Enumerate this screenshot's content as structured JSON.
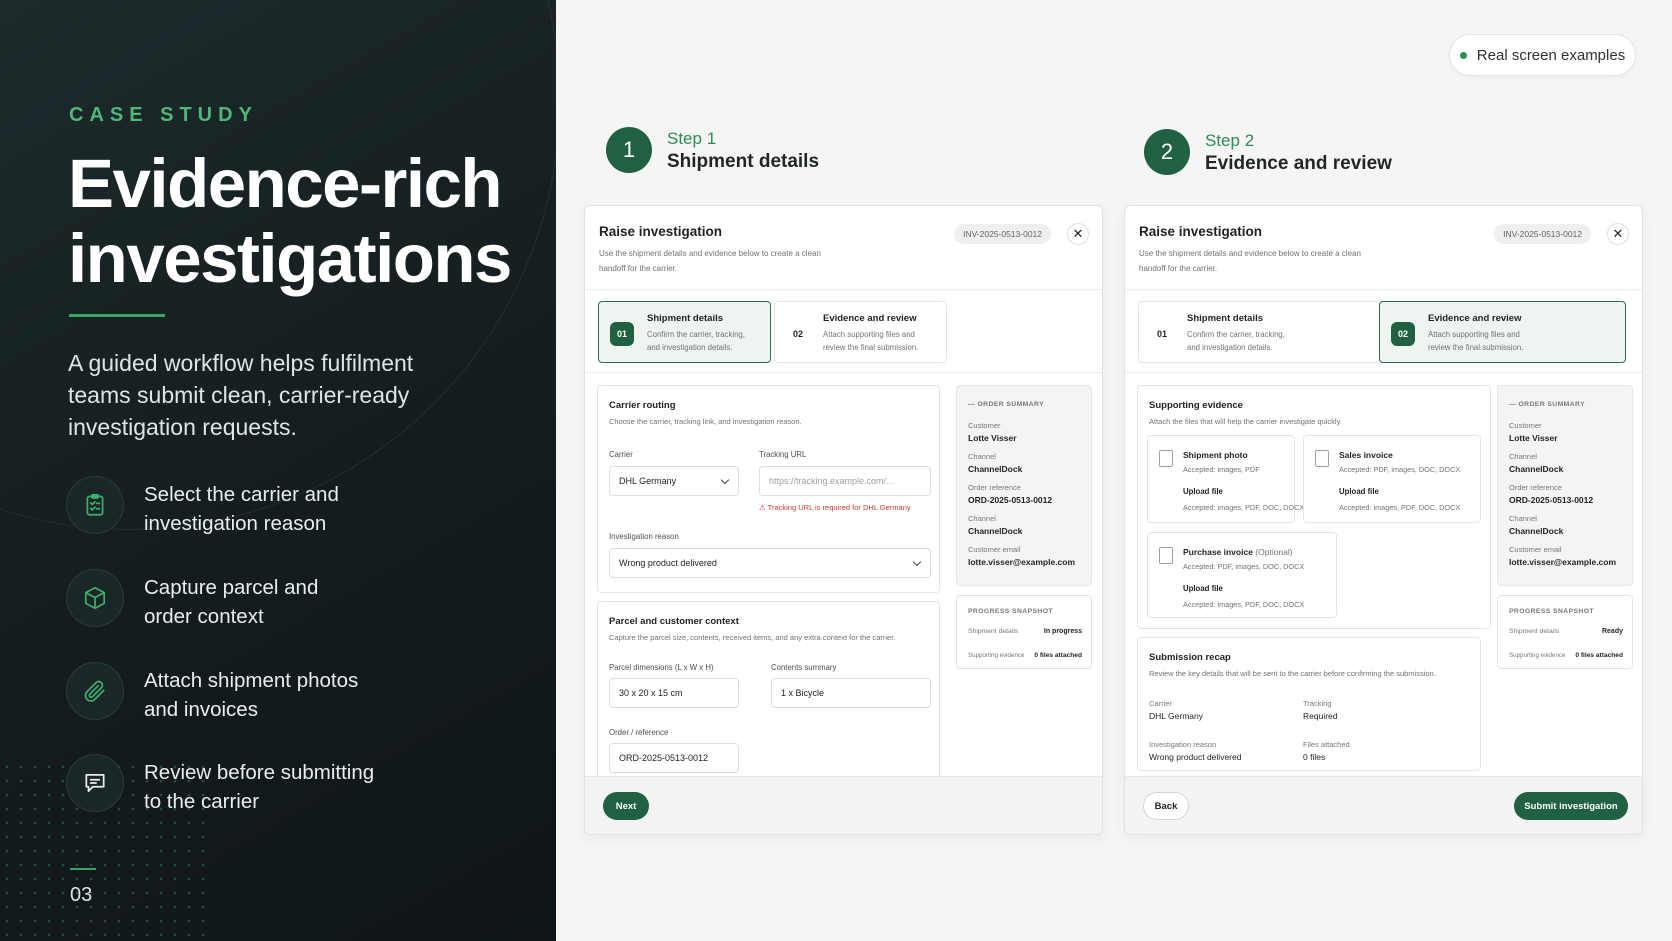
{
  "left": {
    "eyebrow": "CASE STUDY",
    "title_line1": "Evidence-rich",
    "title_line2": "investigations",
    "lead": "A guided workflow helps fulfilment teams submit clean, carrier-ready investigation requests.",
    "features": [
      {
        "icon": "clipboard-check-icon",
        "line1": "Select the carrier and",
        "line2": "investigation reason"
      },
      {
        "icon": "box-icon",
        "line1": "Capture parcel and",
        "line2": "order context"
      },
      {
        "icon": "paperclip-icon",
        "line1": "Attach shipment photos",
        "line2": "and invoices"
      },
      {
        "icon": "message-icon",
        "line1": "Review before submitting",
        "line2": "to the carrier"
      }
    ],
    "page_number": "03"
  },
  "badge": {
    "label": "Real screen examples"
  },
  "steps": [
    {
      "number": "1",
      "label": "Step 1",
      "title": "Shipment details"
    },
    {
      "number": "2",
      "label": "Step 2",
      "title": "Evidence and review"
    }
  ],
  "modal": {
    "title": "Raise investigation",
    "subtitle_line1": "Use the shipment details and evidence below to create a clean",
    "subtitle_line2": "handoff for the carrier.",
    "reference": "INV-2025-0513-0012",
    "close": "✕",
    "tabs": [
      {
        "number": "01",
        "title": "Shipment details",
        "desc_line1": "Confirm the carrier, tracking,",
        "desc_line2": "and investigation details."
      },
      {
        "number": "02",
        "title": "Evidence and review",
        "desc_line1": "Attach supporting files and",
        "desc_line2": "review the final submission."
      }
    ],
    "order_summary": {
      "heading": "ORDER SUMMARY",
      "customer_label": "Customer",
      "customer": "Lotte Visser",
      "channel_label": "Channel",
      "channel": "ChannelDock",
      "order_ref_label": "Order reference",
      "order_ref": "ORD-2025-0513-0012",
      "channel2_label": "Channel",
      "channel2": "ChannelDock",
      "email_label": "Customer email",
      "email": "lotte.visser@example.com"
    },
    "snapshot": {
      "heading": "PROGRESS SNAPSHOT",
      "row1_label": "Shipment details",
      "row2_label": "Supporting evidence",
      "row2_value": "0 files attached"
    }
  },
  "screen1": {
    "carrier_panel": {
      "title": "Carrier routing",
      "desc": "Choose the carrier, tracking link, and investigation reason.",
      "carrier_label": "Carrier",
      "carrier_value": "DHL Germany",
      "tracking_label": "Tracking URL",
      "tracking_placeholder": "https://tracking.example.com/...",
      "tracking_error": "⚠ Tracking URL is required for DHL Germany",
      "reason_label": "Investigation reason",
      "reason_value": "Wrong product delivered"
    },
    "parcel_panel": {
      "title": "Parcel and customer context",
      "desc": "Capture the parcel size, contents, received items, and any extra context for the carrier.",
      "dims_label": "Parcel dimensions (L x W x H)",
      "dims_value": "30 x 20 x 15 cm",
      "contents_label": "Contents summary",
      "contents_value": "1 x Bicycle",
      "order_label": "Order / reference",
      "order_value": "ORD-2025-0513-0012"
    },
    "snapshot_status": "In progress",
    "next_button": "Next"
  },
  "screen2": {
    "evidence_panel": {
      "title": "Supporting evidence",
      "desc": "Attach the files that will help the carrier investigate quickly.",
      "items": [
        {
          "title": "Shipment photo",
          "optional": "",
          "accepted": "Accepted: images, PDF",
          "upload": "Upload file",
          "accepted2": "Accepted: images, PDF, DOC, DOCX"
        },
        {
          "title": "Sales invoice",
          "optional": "",
          "accepted": "Accepted: PDF, images, DOC, DOCX",
          "upload": "Upload file",
          "accepted2": "Accepted: images, PDF, DOC, DOCX"
        },
        {
          "title": "Purchase invoice",
          "optional": "(Optional)",
          "accepted": "Accepted: PDF, images, DOC, DOCX",
          "upload": "Upload file",
          "accepted2": "Accepted: images, PDF, DOC, DOCX"
        }
      ]
    },
    "recap": {
      "title": "Submission recap",
      "desc": "Review the key details that will be sent to the carrier before confirming the submission.",
      "carrier_label": "Carrier",
      "carrier": "DHL Germany",
      "tracking_label": "Tracking",
      "tracking": "Required",
      "reason_label": "Investigation reason",
      "reason": "Wrong product delivered",
      "files_label": "Files attached",
      "files": "0 files"
    },
    "snapshot_status": "Ready",
    "back_button": "Back",
    "submit_button": "Submit investigation"
  },
  "colors": {
    "accent": "#1f6140",
    "accent_light": "#4fb77a",
    "dark_bg": "#161e21",
    "error": "#c63b2e"
  }
}
